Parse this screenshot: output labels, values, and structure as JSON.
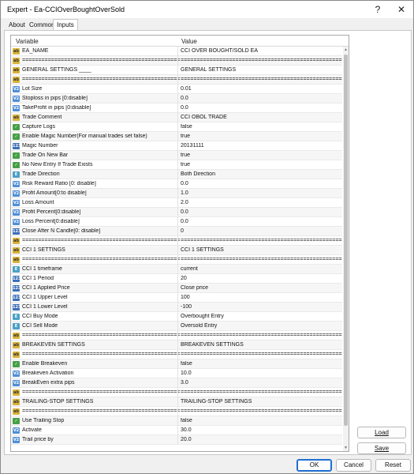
{
  "window": {
    "title": "Expert - Ea-CCIOverBoughtOverSold",
    "help_glyph": "?",
    "close_glyph": "✕"
  },
  "tabs": [
    {
      "label": "About"
    },
    {
      "label": "Common"
    },
    {
      "label": "Inputs"
    }
  ],
  "grid": {
    "header": {
      "variable": "Variable",
      "value": "Value"
    },
    "rows": [
      {
        "icon": "ab",
        "name": "EA_NAME",
        "value": "CCI OVER BOUGHT/SOLD EA"
      },
      {
        "icon": "ab",
        "name": "================================================================",
        "value": "================================================================"
      },
      {
        "icon": "ab",
        "name": "GENERAL SETTINGS ____",
        "value": "GENERAL SETTINGS"
      },
      {
        "icon": "ab",
        "name": "================================================================",
        "value": "================================================================"
      },
      {
        "icon": "num",
        "name": "Lot Size",
        "value": "0.01"
      },
      {
        "icon": "num",
        "name": "Stoploss in pips [0:disable]",
        "value": "0.0"
      },
      {
        "icon": "num",
        "name": "TakeProfit in pips [0:disable]",
        "value": "0.0"
      },
      {
        "icon": "ab",
        "name": "Trade Comment",
        "value": "CCI OBOL TRADE"
      },
      {
        "icon": "bool",
        "name": "Capture Logs",
        "value": "false"
      },
      {
        "icon": "bool",
        "name": "Enable Magic Number(For manual trades set false)",
        "value": "true"
      },
      {
        "icon": "int",
        "name": "Magic Number",
        "value": "20131111"
      },
      {
        "icon": "bool",
        "name": "Trade On New Bar",
        "value": "true"
      },
      {
        "icon": "bool",
        "name": "No New Entry If Trade Exists",
        "value": "true"
      },
      {
        "icon": "enum",
        "name": "Trade Direction",
        "value": "Both Direction"
      },
      {
        "icon": "num",
        "name": "Risk Reward Ratio [0: disable]",
        "value": "0.0"
      },
      {
        "icon": "num",
        "name": "Profit Amount[0:to disable]",
        "value": "1.0"
      },
      {
        "icon": "num",
        "name": "Loss Amount",
        "value": "2.0"
      },
      {
        "icon": "num",
        "name": "Profit Percent[0:disable]",
        "value": "0.0"
      },
      {
        "icon": "num",
        "name": "Loss Percent[0:disable]",
        "value": "0.0"
      },
      {
        "icon": "int",
        "name": "Close After N Candle[0: disable]",
        "value": "0"
      },
      {
        "icon": "ab",
        "name": "================================================================",
        "value": "================================================================"
      },
      {
        "icon": "ab",
        "name": "CCI 1 SETTINGS",
        "value": "CCI 1 SETTINGS"
      },
      {
        "icon": "ab",
        "name": "================================================================",
        "value": "================================================================"
      },
      {
        "icon": "enum",
        "name": "CCI 1 timeframe",
        "value": "current"
      },
      {
        "icon": "int",
        "name": "CCI 1 Period",
        "value": "20"
      },
      {
        "icon": "int",
        "name": "CCI 1 Applied Price",
        "value": "Close price"
      },
      {
        "icon": "int",
        "name": "CCI 1 Upper Level",
        "value": "100"
      },
      {
        "icon": "int",
        "name": "CCI 1 Lower Level",
        "value": "-100"
      },
      {
        "icon": "enum",
        "name": "CCI Buy Mode",
        "value": "Overbought Entry"
      },
      {
        "icon": "enum",
        "name": "CCI Sell Mode",
        "value": "Oversold Entry"
      },
      {
        "icon": "ab",
        "name": "================================================================",
        "value": "================================================================"
      },
      {
        "icon": "ab",
        "name": "BREAKEVEN SETTINGS",
        "value": "BREAKEVEN SETTINGS"
      },
      {
        "icon": "ab",
        "name": "================================================================",
        "value": "================================================================"
      },
      {
        "icon": "bool",
        "name": "Enable Breakeven",
        "value": "false"
      },
      {
        "icon": "num",
        "name": "Breakeven Activation",
        "value": "10.0"
      },
      {
        "icon": "num",
        "name": "BreakEven extra pips",
        "value": "3.0"
      },
      {
        "icon": "ab",
        "name": "================================================================",
        "value": "================================================================"
      },
      {
        "icon": "ab",
        "name": "TRAILING-STOP SETTINGS",
        "value": "TRAILING-STOP SETTINGS"
      },
      {
        "icon": "ab",
        "name": "================================================================",
        "value": "================================================================"
      },
      {
        "icon": "bool",
        "name": "Use Trailing Stop",
        "value": "false"
      },
      {
        "icon": "num",
        "name": "Activate",
        "value": "30.0"
      },
      {
        "icon": "num",
        "name": "Trail price by",
        "value": "20.0"
      }
    ]
  },
  "side_buttons": {
    "load": "Load",
    "save": "Save"
  },
  "footer_buttons": {
    "ok": "OK",
    "cancel": "Cancel",
    "reset": "Reset"
  }
}
